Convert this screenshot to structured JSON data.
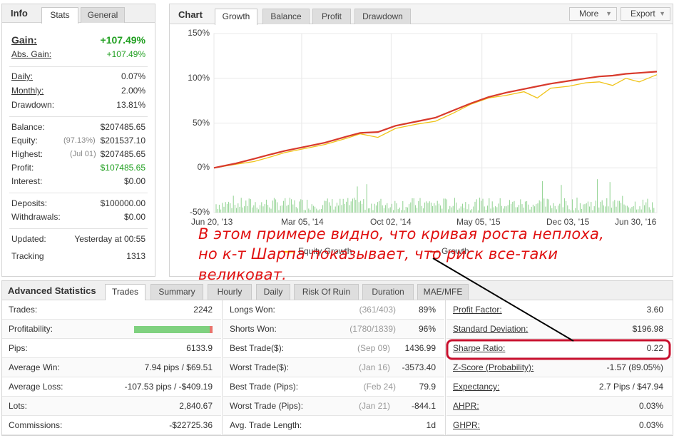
{
  "info": {
    "title": "Info",
    "tabs": [
      "Stats",
      "General"
    ],
    "gain_label": "Gain:",
    "gain_value": "+107.49%",
    "abs_gain_label": "Abs. Gain:",
    "abs_gain_value": "+107.49%",
    "daily_label": "Daily:",
    "daily_value": "0.07%",
    "monthly_label": "Monthly:",
    "monthly_value": "2.00%",
    "drawdown_label": "Drawdown:",
    "drawdown_value": "13.81%",
    "balance_label": "Balance:",
    "balance_value": "$207485.65",
    "equity_label": "Equity:",
    "equity_pct": "(97.13%)",
    "equity_value": "$201537.10",
    "highest_label": "Highest:",
    "highest_date": "(Jul 01)",
    "highest_value": "$207485.65",
    "profit_label": "Profit:",
    "profit_value": "$107485.65",
    "interest_label": "Interest:",
    "interest_value": "$0.00",
    "deposits_label": "Deposits:",
    "deposits_value": "$100000.00",
    "withdrawals_label": "Withdrawals:",
    "withdrawals_value": "$0.00",
    "updated_label": "Updated:",
    "updated_value": "Yesterday at 00:55",
    "tracking_label": "Tracking",
    "tracking_value": "1313"
  },
  "chart_panel": {
    "title": "Chart",
    "tabs": [
      "Growth",
      "Balance",
      "Profit",
      "Drawdown"
    ],
    "more_label": "More",
    "export_label": "Export"
  },
  "chart_data": {
    "type": "line",
    "x_ticks": [
      "Jun 20, '13",
      "Mar 05, '14",
      "Oct 02, '14",
      "May 05, '15",
      "Dec 03, '15",
      "Jun 30, '16"
    ],
    "y_ticks": [
      "150%",
      "100%",
      "50%",
      "0%",
      "-50%"
    ],
    "ylim": [
      -50,
      150
    ],
    "grid": true,
    "legend_position": "bottom",
    "series": [
      {
        "name": "Equity Growth",
        "color": "#f0c419",
        "x": [
          0,
          0.05,
          0.09,
          0.12,
          0.16,
          0.2,
          0.25,
          0.3,
          0.33,
          0.37,
          0.41,
          0.46,
          0.5,
          0.54,
          0.58,
          0.62,
          0.66,
          0.7,
          0.73,
          0.76,
          0.8,
          0.84,
          0.87,
          0.9,
          0.93,
          0.96,
          1.0
        ],
        "values": [
          0,
          4,
          7,
          11,
          17,
          21,
          26,
          33,
          38,
          34,
          44,
          49,
          52,
          61,
          71,
          78,
          81,
          85,
          78,
          89,
          91,
          95,
          96,
          92,
          100,
          96,
          104
        ]
      },
      {
        "name": "Growth",
        "color": "#d83a2c",
        "x": [
          0,
          0.05,
          0.09,
          0.12,
          0.16,
          0.2,
          0.25,
          0.3,
          0.33,
          0.37,
          0.41,
          0.46,
          0.5,
          0.54,
          0.58,
          0.62,
          0.66,
          0.7,
          0.73,
          0.76,
          0.8,
          0.84,
          0.87,
          0.9,
          0.93,
          0.96,
          1.0
        ],
        "values": [
          0,
          5,
          10,
          14,
          19,
          23,
          28,
          35,
          39,
          40,
          47,
          52,
          56,
          64,
          72,
          79,
          84,
          88,
          91,
          94,
          97,
          100,
          102,
          103,
          105,
          106,
          107.49
        ]
      }
    ]
  },
  "annotation": {
    "line1": "В этом примере видно, что кривая роста неплоха,",
    "line2": "но к-т Шарпа показывает, что риск все-таки",
    "line3": "великоват."
  },
  "adv": {
    "title": "Advanced Statistics",
    "tabs": [
      "Trades",
      "Summary",
      "Hourly",
      "Daily",
      "Risk Of Ruin",
      "Duration",
      "MAE/MFE"
    ],
    "col1": [
      {
        "label": "Trades:",
        "value": "2242"
      },
      {
        "label": "Profitability:",
        "value": ""
      },
      {
        "label": "Pips:",
        "value": "6133.9"
      },
      {
        "label": "Average Win:",
        "value": "7.94 pips / $69.51"
      },
      {
        "label": "Average Loss:",
        "value": "-107.53 pips / -$409.19"
      },
      {
        "label": "Lots:",
        "value": "2,840.67"
      },
      {
        "label": "Commissions:",
        "value": "-$22725.36"
      }
    ],
    "profitability_win_fraction": 0.96,
    "col2": [
      {
        "label": "Longs Won:",
        "meta": "(361/403)",
        "value": "89%"
      },
      {
        "label": "Shorts Won:",
        "meta": "(1780/1839)",
        "value": "96%"
      },
      {
        "label": "Best Trade($):",
        "meta": "(Sep 09)",
        "value": "1436.99"
      },
      {
        "label": "Worst Trade($):",
        "meta": "(Jan 16)",
        "value": "-3573.40"
      },
      {
        "label": "Best Trade (Pips):",
        "meta": "(Feb 24)",
        "value": "79.9"
      },
      {
        "label": "Worst Trade (Pips):",
        "meta": "(Jan 21)",
        "value": "-844.1"
      },
      {
        "label": "Avg. Trade Length:",
        "meta": "",
        "value": "1d"
      }
    ],
    "col3": [
      {
        "label": "Profit Factor:",
        "value": "3.60"
      },
      {
        "label": "Standard Deviation:",
        "value": "$196.98"
      },
      {
        "label": "Sharpe Ratio:",
        "value": "0.22"
      },
      {
        "label": "Z-Score (Probability):",
        "value": "-1.57 (89.05%)"
      },
      {
        "label": "Expectancy:",
        "value": "2.7 Pips / $47.94"
      },
      {
        "label": "AHPR:",
        "value": "0.03%"
      },
      {
        "label": "GHPR:",
        "value": "0.03%"
      }
    ]
  },
  "colors": {
    "accent_green": "#22a022",
    "highlight_red": "#c8102e",
    "equity": "#f0c419",
    "growth": "#d83a2c",
    "volume": "#8fd18f"
  }
}
